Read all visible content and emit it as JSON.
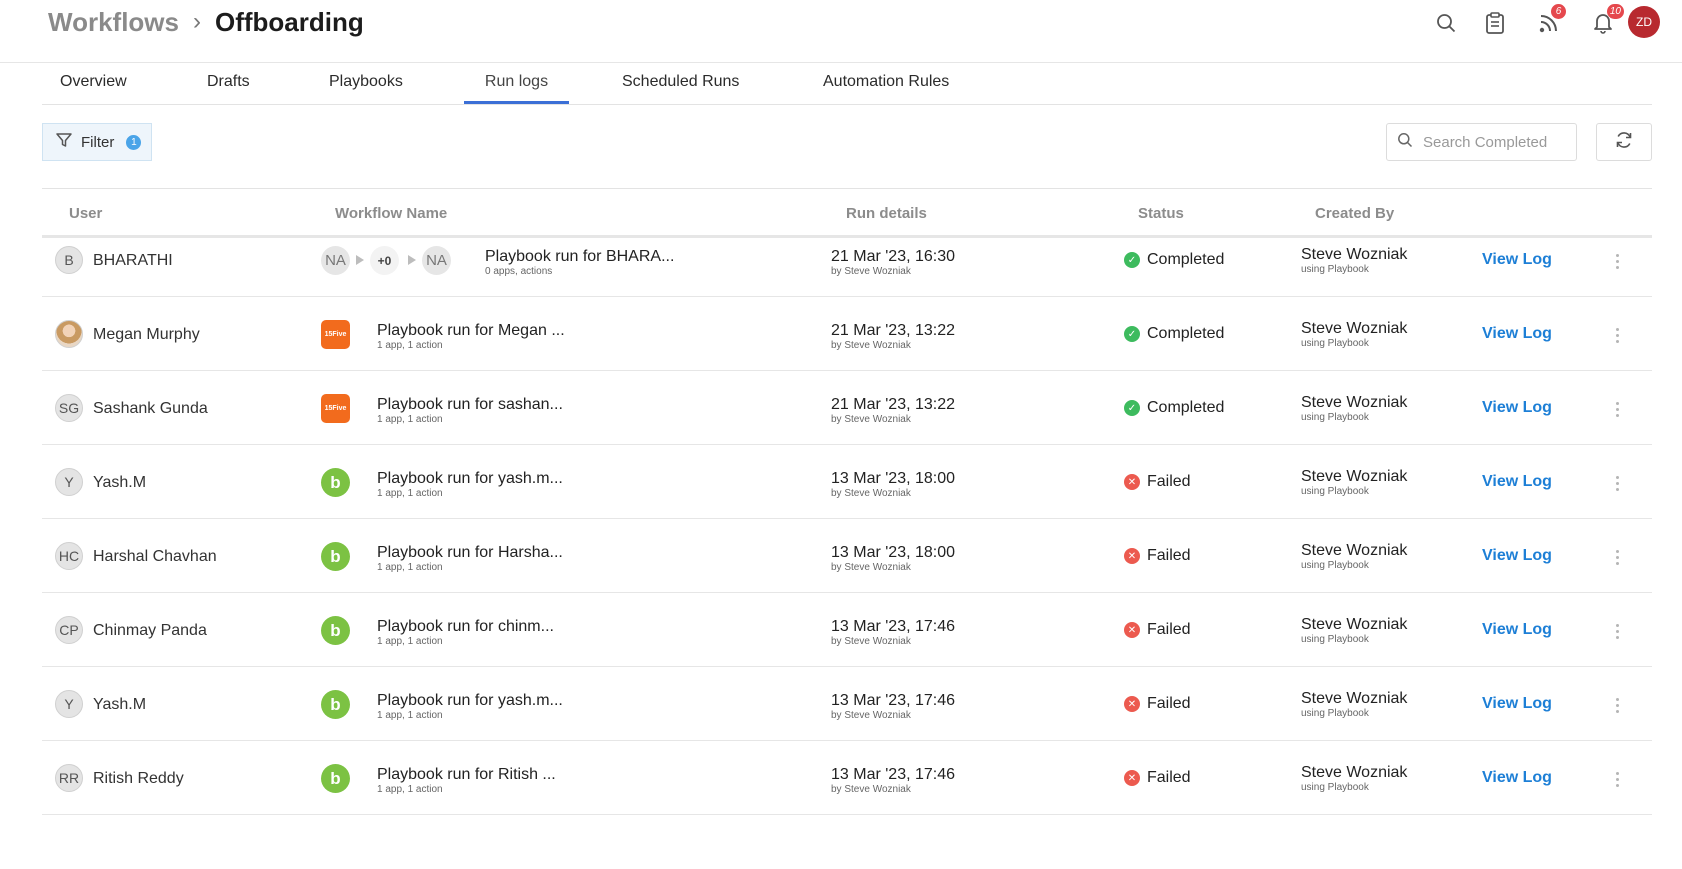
{
  "breadcrumb": {
    "root": "Workflows",
    "separator": "›",
    "current": "Offboarding"
  },
  "header_icons": {
    "search": "search-icon",
    "tasks": "clipboard-icon",
    "feed": "rss-icon",
    "feed_badge": "6",
    "notifications": "bell-icon",
    "notifications_badge": "10",
    "avatar_initials": "ZD"
  },
  "tabs": [
    {
      "label": "Overview"
    },
    {
      "label": "Drafts"
    },
    {
      "label": "Playbooks"
    },
    {
      "label": "Run logs",
      "active": true
    },
    {
      "label": "Scheduled Runs"
    },
    {
      "label": "Automation Rules"
    }
  ],
  "toolbar": {
    "filter_label": "Filter",
    "filter_count": "1",
    "search_placeholder": "Search Completed"
  },
  "columns": {
    "user": "User",
    "workflow": "Workflow Name",
    "run_details": "Run details",
    "status": "Status",
    "created_by": "Created By"
  },
  "colors": {
    "accent": "#3b6fd6",
    "link": "#1d7fd6",
    "success": "#3dbb5e",
    "failed": "#ec5a4f"
  },
  "rows": [
    {
      "user_initials": "B",
      "user_name": "BHARATHI",
      "user_photo": false,
      "app_type": "chain",
      "chain": {
        "first": "NA",
        "middle": "+0",
        "last": "NA"
      },
      "workflow_name": "Playbook run for BHARA...",
      "workflow_sub": "0 apps, actions",
      "run_date": "21 Mar '23, 16:30",
      "run_by": "by Steve Wozniak",
      "status": "Completed",
      "status_kind": "ok",
      "created_by": "Steve Wozniak",
      "created_sub": "using Playbook",
      "action": "View Log"
    },
    {
      "user_initials": "",
      "user_name": "Megan Murphy",
      "user_photo": true,
      "app_type": "orange",
      "app_label": "15Five",
      "workflow_name": "Playbook run for Megan ...",
      "workflow_sub": "1 app, 1 action",
      "run_date": "21 Mar '23, 13:22",
      "run_by": "by Steve Wozniak",
      "status": "Completed",
      "status_kind": "ok",
      "created_by": "Steve Wozniak",
      "created_sub": "using Playbook",
      "action": "View Log"
    },
    {
      "user_initials": "SG",
      "user_name": "Sashank Gunda",
      "user_photo": false,
      "app_type": "orange",
      "app_label": "15Five",
      "workflow_name": "Playbook run for sashan...",
      "workflow_sub": "1 app, 1 action",
      "run_date": "21 Mar '23, 13:22",
      "run_by": "by Steve Wozniak",
      "status": "Completed",
      "status_kind": "ok",
      "created_by": "Steve Wozniak",
      "created_sub": "using Playbook",
      "action": "View Log"
    },
    {
      "user_initials": "Y",
      "user_name": "Yash.M",
      "user_photo": false,
      "app_type": "green",
      "app_label": "b",
      "workflow_name": "Playbook run for yash.m...",
      "workflow_sub": "1 app, 1 action",
      "run_date": "13 Mar '23, 18:00",
      "run_by": "by Steve Wozniak",
      "status": "Failed",
      "status_kind": "fail",
      "created_by": "Steve Wozniak",
      "created_sub": "using Playbook",
      "action": "View Log"
    },
    {
      "user_initials": "HC",
      "user_name": "Harshal Chavhan",
      "user_photo": false,
      "app_type": "green",
      "app_label": "b",
      "workflow_name": "Playbook run for Harsha...",
      "workflow_sub": "1 app, 1 action",
      "run_date": "13 Mar '23, 18:00",
      "run_by": "by Steve Wozniak",
      "status": "Failed",
      "status_kind": "fail",
      "created_by": "Steve Wozniak",
      "created_sub": "using Playbook",
      "action": "View Log"
    },
    {
      "user_initials": "CP",
      "user_name": "Chinmay Panda",
      "user_photo": false,
      "app_type": "green",
      "app_label": "b",
      "workflow_name": "Playbook run for chinm...",
      "workflow_sub": "1 app, 1 action",
      "run_date": "13 Mar '23, 17:46",
      "run_by": "by Steve Wozniak",
      "status": "Failed",
      "status_kind": "fail",
      "created_by": "Steve Wozniak",
      "created_sub": "using Playbook",
      "action": "View Log"
    },
    {
      "user_initials": "Y",
      "user_name": "Yash.M",
      "user_photo": false,
      "app_type": "green",
      "app_label": "b",
      "workflow_name": "Playbook run for yash.m...",
      "workflow_sub": "1 app, 1 action",
      "run_date": "13 Mar '23, 17:46",
      "run_by": "by Steve Wozniak",
      "status": "Failed",
      "status_kind": "fail",
      "created_by": "Steve Wozniak",
      "created_sub": "using Playbook",
      "action": "View Log"
    },
    {
      "user_initials": "RR",
      "user_name": "Ritish Reddy",
      "user_photo": false,
      "app_type": "green",
      "app_label": "b",
      "workflow_name": "Playbook run for Ritish ...",
      "workflow_sub": "1 app, 1 action",
      "run_date": "13 Mar '23, 17:46",
      "run_by": "by Steve Wozniak",
      "status": "Failed",
      "status_kind": "fail",
      "created_by": "Steve Wozniak",
      "created_sub": "using Playbook",
      "action": "View Log"
    }
  ]
}
